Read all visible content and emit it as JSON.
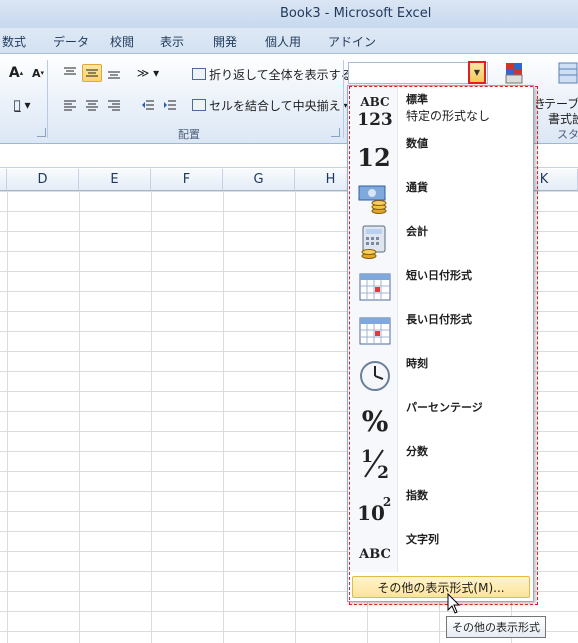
{
  "window": {
    "title": "Book3 - Microsoft Excel"
  },
  "tabs": [
    "数式",
    "データ",
    "校閲",
    "表示",
    "開発",
    "個人用",
    "アドイン"
  ],
  "ribbon": {
    "wrap_text": "折り返して全体を表示する",
    "merge_center": "セルを結合して中央揃え",
    "alignment_group": "配置",
    "table_label_1": "テーブル",
    "table_label_2": "書式設",
    "style_label": "スタ",
    "partial_label": "き",
    "font_grow": "A",
    "font_shrink": "A"
  },
  "columns": [
    "D",
    "E",
    "F",
    "G",
    "H",
    "K"
  ],
  "number_format_menu": {
    "items": [
      {
        "name": "標準",
        "sub": "特定の形式なし",
        "icon": "abc-123-icon"
      },
      {
        "name": "数値",
        "icon": "number-12-icon"
      },
      {
        "name": "通貨",
        "icon": "currency-icon"
      },
      {
        "name": "会計",
        "icon": "accounting-icon"
      },
      {
        "name": "短い日付形式",
        "icon": "short-date-calendar-icon"
      },
      {
        "name": "長い日付形式",
        "icon": "long-date-calendar-icon"
      },
      {
        "name": "時刻",
        "icon": "clock-icon"
      },
      {
        "name": "パーセンテージ",
        "icon": "percent-icon"
      },
      {
        "name": "分数",
        "icon": "fraction-icon"
      },
      {
        "name": "指数",
        "icon": "exponent-icon"
      },
      {
        "name": "文字列",
        "icon": "text-abc-icon"
      }
    ],
    "more_formats": "その他の表示形式(M)...",
    "tooltip": "その他の表示形式"
  },
  "icon_text": {
    "abc": "ABC",
    "n123": "123",
    "n12": "12",
    "pct": "%",
    "frac_num": "1",
    "frac_den": "2",
    "exp_base": "10",
    "exp_pow": "2",
    "abc2": "ABC"
  },
  "colors": {
    "highlight_red": "#e02020",
    "hover_gold": "#fde49a"
  }
}
